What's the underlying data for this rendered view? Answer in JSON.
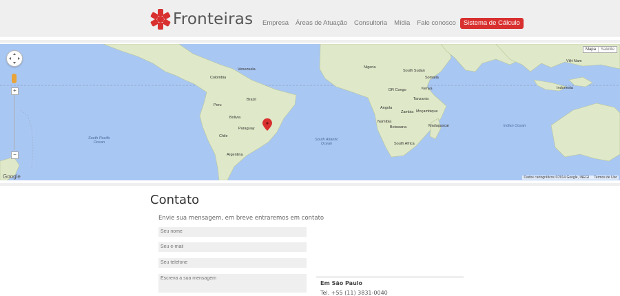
{
  "brand": {
    "name": "Fronteiras"
  },
  "nav": {
    "items": [
      "Empresa",
      "Áreas de Atuação",
      "Consultoria",
      "Mídia",
      "Fale conosco"
    ],
    "cta": "Sistema de Cálculo"
  },
  "map": {
    "type_buttons": [
      "Mapa",
      "Satélite"
    ],
    "attribution": "Dados cartográficos ©2014 Google, INEGI",
    "terms": "Termos de Uso",
    "logo": "Google",
    "labels": {
      "colombia": "Colombia",
      "peru": "Peru",
      "brazil": "Brazil",
      "bolivia": "Bolivia",
      "paraguay": "Paraguay",
      "chile": "Chile",
      "argentina": "Argentina",
      "venezuela": "Venezuela",
      "nigeria": "Nigeria",
      "drc": "DR Congo",
      "angola": "Angola",
      "zambia": "Zambia",
      "namibia": "Namibia",
      "botswana": "Botswana",
      "south_africa": "South Africa",
      "somalia": "Somalia",
      "kenya": "Kenya",
      "tanzania": "Tanzania",
      "mozambique": "Moçambique",
      "madagascar": "Madagascar",
      "south_sudan": "South Sudan",
      "indonesia": "Indonesia",
      "vietnam": "Việt Nam",
      "south_pacific_ocean": "South Pacific Ocean",
      "south_atlantic_ocean": "South Atlantic Ocean",
      "indian_ocean": "Indian Ocean"
    }
  },
  "contact": {
    "title": "Contato",
    "intro": "Envie sua mensagem, em breve entraremos em contato",
    "name_placeholder": "Seu nome",
    "email_placeholder": "Seu e-mail",
    "phone_placeholder": "Seu telefone",
    "message_placeholder": "Escreva a sua mensagem",
    "office_city": "Em São Paulo",
    "office_phone": "Tel. +55 (11) 3831-0040"
  },
  "colors": {
    "accent": "#d8302f",
    "ocean": "#a9c7f3",
    "land": "#dfe8c8"
  }
}
